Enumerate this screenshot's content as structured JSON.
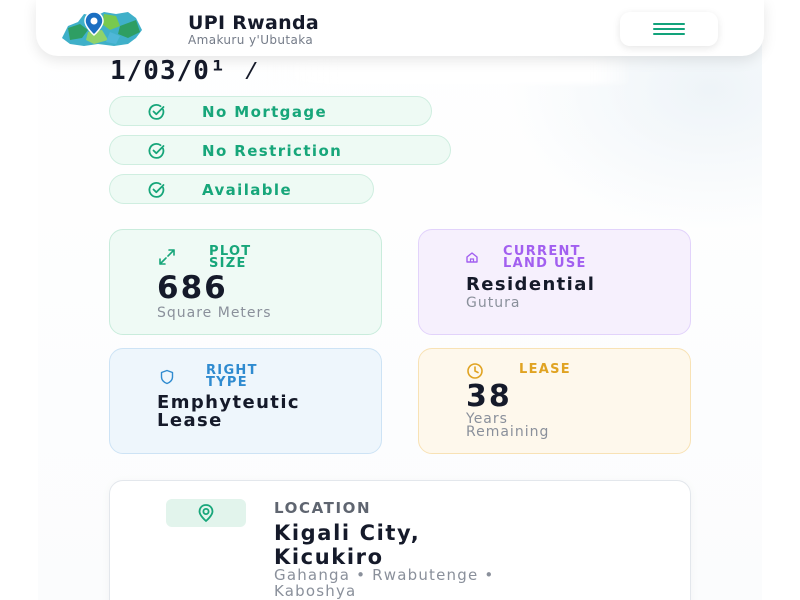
{
  "header": {
    "app_title": "UPI Rwanda",
    "app_subtitle": "Amakuru y'Ubutaka",
    "menu_icon": "hamburger-icon",
    "logo_icon": "rwanda-map-pin-icon"
  },
  "parcel": {
    "upi_visible": "1/03/0¹ ⁄"
  },
  "status_pills": [
    {
      "label": "No Mortgage",
      "icon": "check-circle-icon"
    },
    {
      "label": "No Restriction",
      "icon": "check-circle-icon"
    },
    {
      "label": "Available",
      "icon": "check-circle-icon"
    }
  ],
  "cards": {
    "plot_size": {
      "label_line1": "PLOT",
      "label_line2": "SIZE",
      "value": "686",
      "unit": "Square Meters",
      "icon": "expand-arrows-icon"
    },
    "land_use": {
      "label_line1": "CURRENT",
      "label_line2": "LAND USE",
      "value": "Residential",
      "sub": "Gutura",
      "icon": "home-icon"
    },
    "right_type": {
      "label_line1": "RIGHT",
      "label_line2": "TYPE",
      "value_line1": "Emphyteutic",
      "value_line2": "Lease",
      "icon": "shield-icon"
    },
    "lease": {
      "label": "LEASE",
      "value": "38",
      "sub_line1": "Years",
      "sub_line2": "Remaining",
      "icon": "clock-icon"
    }
  },
  "location": {
    "label": "LOCATION",
    "city_line1": "Kigali City,",
    "city_line2": "Kicukiro",
    "cells_line1": "Gahanga • Rwabutenge •",
    "cells_line2": "Kaboshya",
    "icon": "location-pin-icon"
  },
  "colors": {
    "green": "#17a67a",
    "purple": "#a25ff0",
    "blue": "#2f8bd0",
    "amber": "#e0a322",
    "dark_text": "#151a2a",
    "muted_text": "#8a909b"
  }
}
